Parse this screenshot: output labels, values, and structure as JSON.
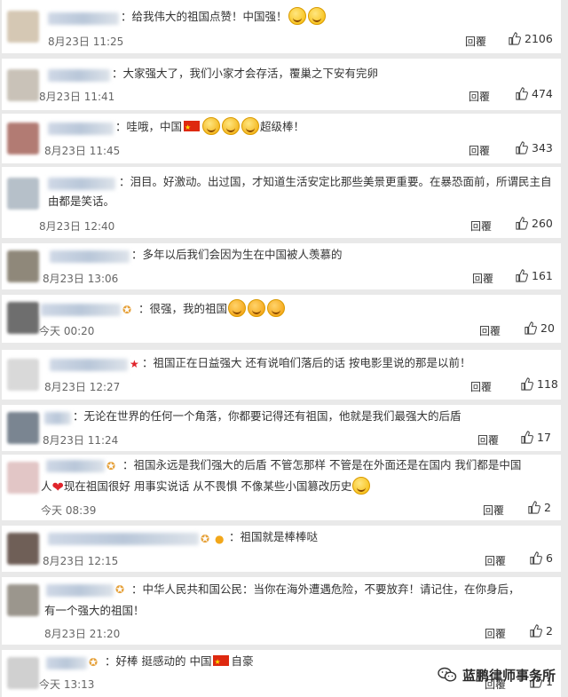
{
  "comments": [
    {
      "text": "：给我伟大的祖国点赞！中国强！",
      "emoji": [
        "smile",
        "smile"
      ],
      "date": "8月23日 11:25",
      "reply": "回覆",
      "likes": "2106",
      "avatar_color": "#d5c8b4"
    },
    {
      "text": "：大家强大了，我们小家才会存活，覆巢之下安有完卵",
      "emoji": [],
      "date": "8月23日 11:41",
      "reply": "回覆",
      "likes": "474",
      "avatar_color": "#c9c2b8"
    },
    {
      "text_before": "：哇哦，中国",
      "text_after": "超级棒！",
      "emoji": [
        "cry",
        "cry",
        "cry"
      ],
      "date": "8月23日 11:45",
      "reply": "回覆",
      "likes": "343",
      "avatar_color": "#b27b73"
    },
    {
      "text": "：泪目。好激动。出过国，才知道生活安定比那些美景更重要。在暴恐面前，所谓民主自由都是笑话。",
      "emoji": [],
      "date": "8月23日 12:40",
      "reply": "回覆",
      "likes": "260",
      "avatar_color": "#b6c0c9"
    },
    {
      "text": "：多年以后我们会因为生在中国被人羡慕的",
      "emoji": [],
      "date": "8月23日 13:06",
      "reply": "回覆",
      "likes": "161",
      "avatar_color": "#8f887a"
    },
    {
      "text": "：很强，我的祖国",
      "emoji": [
        "blush",
        "blush",
        "blush"
      ],
      "date": "今天 00:20",
      "reply": "回覆",
      "likes": "20",
      "avatar_color": "#6e6e6e"
    },
    {
      "text": "：祖国正在日益强大 还有说咱们落后的话 按电影里说的那是以前！",
      "emoji": [],
      "date": "8月23日 12:27",
      "reply": "回覆",
      "likes": "118",
      "avatar_color": "#d9d9d9"
    },
    {
      "text": "：无论在世界的任何一个角落，你都要记得还有祖国，他就是我们最强大的后盾",
      "emoji": [],
      "date": "8月23日 11:24",
      "reply": "回覆",
      "likes": "17",
      "avatar_color": "#7a8591"
    },
    {
      "text_line1": "：祖国永远是我们强大的后盾 不管怎那样 不管是在外面还是在国内 我们都是中国",
      "text_line2_a": "人",
      "text_line2_b": "现在祖国很好 用事实说话 从不畏惧 不像某些小国篡改历史",
      "emoji": [
        "smile"
      ],
      "date": "今天 08:39",
      "reply": "回覆",
      "likes": "2",
      "avatar_color": "#e2c6c6"
    },
    {
      "text": "：祖国就是棒棒哒",
      "emoji": [],
      "date": "8月23日 12:15",
      "reply": "回覆",
      "likes": "6",
      "avatar_color": "#6f5f57"
    },
    {
      "text_line1": "：中华人民共和国公民：当你在海外遭遇危险，不要放弃！请记住，在你身后，",
      "text_line2": "有一个强大的祖国！",
      "emoji": [],
      "date": "8月23日 21:20",
      "reply": "回覆",
      "likes": "2",
      "avatar_color": "#9b968d"
    },
    {
      "text_before": "：好棒 挺感动的 中国",
      "text_after": "自豪",
      "emoji": [],
      "date": "今天 13:13",
      "reply": "回覆",
      "likes": "1",
      "avatar_color": "#d0d0d0"
    }
  ],
  "watermark": {
    "text": "蓝鹏律师事务所",
    "icon": "wechat-logo-icon"
  },
  "colors": {
    "background": "#e9e9e9",
    "card": "#ffffff",
    "text": "#333333",
    "flag_red": "#de2910",
    "heart_red": "#e0242b"
  }
}
